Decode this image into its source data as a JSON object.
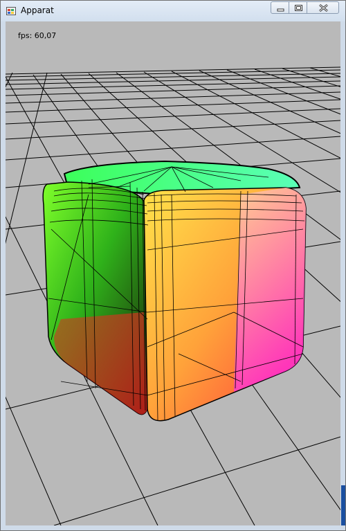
{
  "window": {
    "title": "Apparat",
    "icons": {
      "app": "app-window-icon",
      "minimize": "minimize-icon",
      "maximize": "maximize-icon",
      "close": "close-icon"
    }
  },
  "overlay": {
    "fps": "fps: 60,07"
  },
  "scene": {
    "background": "#b9b9b9",
    "grid_color": "#000000",
    "object": "rounded-cube"
  }
}
